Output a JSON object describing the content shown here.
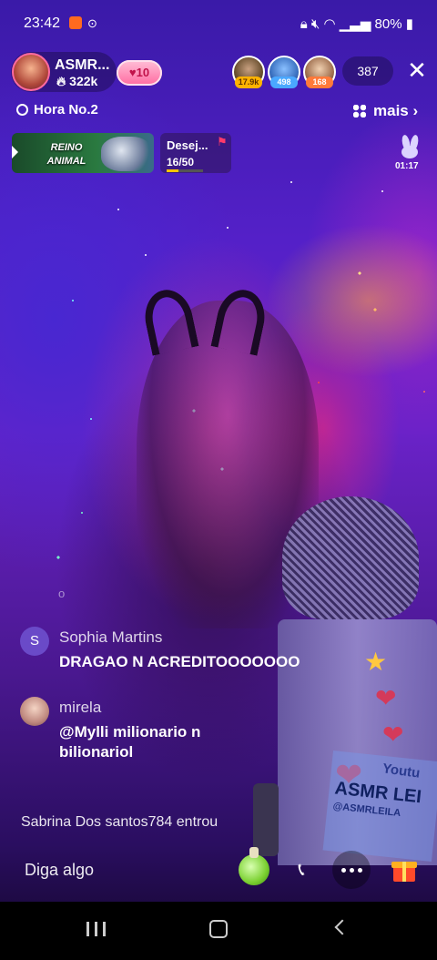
{
  "status_bar": {
    "time": "23:42",
    "battery": "80%",
    "notification_icons": [
      "app-notification-icon",
      "screen-record-icon"
    ],
    "system_icons": [
      "lock-icon",
      "mute-icon",
      "wifi-icon",
      "signal-icon",
      "battery-icon"
    ]
  },
  "host": {
    "name": "ASMR...",
    "likes": "322k",
    "level": "10"
  },
  "viewers": [
    {
      "badge": "17.9k",
      "badge_color": "#ffb300"
    },
    {
      "badge": "498",
      "badge_color": "#4aa8ff"
    },
    {
      "badge": "168",
      "badge_color": "#ff7a3a"
    }
  ],
  "viewer_count": "387",
  "ranking": {
    "label": "Hora No.2"
  },
  "more": {
    "label": "mais"
  },
  "event_banner": {
    "text": "REINO ANIMAL"
  },
  "goal": {
    "label": "Desej...",
    "progress_text": "16/50",
    "progress": 0.32
  },
  "timer": "01:17",
  "chat": [
    {
      "name": "Sophia Martins",
      "avatar_letter": "S",
      "message": "DRAGAO N ACREDITOOOOOOO"
    },
    {
      "name": "mirela",
      "avatar_letter": "",
      "message_line1": "@Mylli milionario n",
      "message_line2": "bilionariol"
    }
  ],
  "system_hint": "o",
  "join_message": "Sabrina Dos santos784 entrou",
  "input": {
    "placeholder": "Diga algo"
  },
  "background_sign": {
    "text": "ASMR LEI",
    "corner": "Youtu",
    "handle": "@ASMRLEILA"
  },
  "colors": {
    "level_badge": "#ff6aa0",
    "accent": "#ffc400",
    "chat_avatar": "#6a4ac8"
  }
}
